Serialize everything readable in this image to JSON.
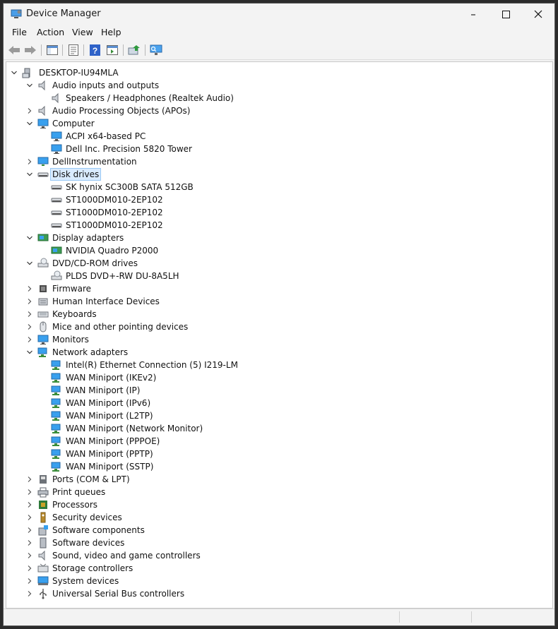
{
  "window": {
    "title": "Device Manager"
  },
  "menu": {
    "items": [
      "File",
      "Action",
      "View",
      "Help"
    ]
  },
  "toolbar": {
    "icons": [
      "back-icon",
      "forward-icon",
      "show-hide-tree-icon",
      "properties-icon",
      "help-icon",
      "action-pane-icon",
      "update-driver-icon",
      "scan-hardware-icon"
    ]
  },
  "tree": {
    "rows": [
      {
        "label": "DESKTOP-IU94MLA",
        "level": 0,
        "expander": "open",
        "icon": "computer-root"
      },
      {
        "label": "Audio inputs and outputs",
        "level": 1,
        "expander": "open",
        "icon": "speaker"
      },
      {
        "label": "Speakers / Headphones (Realtek Audio)",
        "level": 2,
        "expander": "none",
        "icon": "speaker"
      },
      {
        "label": "Audio Processing Objects (APOs)",
        "level": 1,
        "expander": "closed",
        "icon": "speaker"
      },
      {
        "label": "Computer",
        "level": 1,
        "expander": "open",
        "icon": "monitor"
      },
      {
        "label": "ACPI x64-based PC",
        "level": 2,
        "expander": "none",
        "icon": "monitor"
      },
      {
        "label": "Dell Inc. Precision 5820 Tower",
        "level": 2,
        "expander": "none",
        "icon": "monitor"
      },
      {
        "label": "DellInstrumentation",
        "level": 1,
        "expander": "closed",
        "icon": "monitor-net"
      },
      {
        "label": "Disk drives",
        "level": 1,
        "expander": "open",
        "icon": "disk",
        "selected": true
      },
      {
        "label": "SK hynix SC300B SATA 512GB",
        "level": 2,
        "expander": "none",
        "icon": "disk"
      },
      {
        "label": "ST1000DM010-2EP102",
        "level": 2,
        "expander": "none",
        "icon": "disk"
      },
      {
        "label": "ST1000DM010-2EP102",
        "level": 2,
        "expander": "none",
        "icon": "disk"
      },
      {
        "label": "ST1000DM010-2EP102",
        "level": 2,
        "expander": "none",
        "icon": "disk"
      },
      {
        "label": "Display adapters",
        "level": 1,
        "expander": "open",
        "icon": "display-adapter"
      },
      {
        "label": "NVIDIA Quadro P2000",
        "level": 2,
        "expander": "none",
        "icon": "display-adapter"
      },
      {
        "label": "DVD/CD-ROM drives",
        "level": 1,
        "expander": "open",
        "icon": "dvd"
      },
      {
        "label": "PLDS DVD+-RW DU-8A5LH",
        "level": 2,
        "expander": "none",
        "icon": "dvd"
      },
      {
        "label": "Firmware",
        "level": 1,
        "expander": "closed",
        "icon": "chip"
      },
      {
        "label": "Human Interface Devices",
        "level": 1,
        "expander": "closed",
        "icon": "hid"
      },
      {
        "label": "Keyboards",
        "level": 1,
        "expander": "closed",
        "icon": "keyboard"
      },
      {
        "label": "Mice and other pointing devices",
        "level": 1,
        "expander": "closed",
        "icon": "mouse"
      },
      {
        "label": "Monitors",
        "level": 1,
        "expander": "closed",
        "icon": "monitor"
      },
      {
        "label": "Network adapters",
        "level": 1,
        "expander": "open",
        "icon": "network"
      },
      {
        "label": "Intel(R) Ethernet Connection (5) I219-LM",
        "level": 2,
        "expander": "none",
        "icon": "network"
      },
      {
        "label": "WAN Miniport (IKEv2)",
        "level": 2,
        "expander": "none",
        "icon": "network"
      },
      {
        "label": "WAN Miniport (IP)",
        "level": 2,
        "expander": "none",
        "icon": "network"
      },
      {
        "label": "WAN Miniport (IPv6)",
        "level": 2,
        "expander": "none",
        "icon": "network"
      },
      {
        "label": "WAN Miniport (L2TP)",
        "level": 2,
        "expander": "none",
        "icon": "network"
      },
      {
        "label": "WAN Miniport (Network Monitor)",
        "level": 2,
        "expander": "none",
        "icon": "network"
      },
      {
        "label": "WAN Miniport (PPPOE)",
        "level": 2,
        "expander": "none",
        "icon": "network"
      },
      {
        "label": "WAN Miniport (PPTP)",
        "level": 2,
        "expander": "none",
        "icon": "network"
      },
      {
        "label": "WAN Miniport (SSTP)",
        "level": 2,
        "expander": "none",
        "icon": "network"
      },
      {
        "label": "Ports (COM & LPT)",
        "level": 1,
        "expander": "closed",
        "icon": "port"
      },
      {
        "label": "Print queues",
        "level": 1,
        "expander": "closed",
        "icon": "printer"
      },
      {
        "label": "Processors",
        "level": 1,
        "expander": "closed",
        "icon": "processor"
      },
      {
        "label": "Security devices",
        "level": 1,
        "expander": "closed",
        "icon": "security"
      },
      {
        "label": "Software components",
        "level": 1,
        "expander": "closed",
        "icon": "software-component"
      },
      {
        "label": "Software devices",
        "level": 1,
        "expander": "closed",
        "icon": "software-device"
      },
      {
        "label": "Sound, video and game controllers",
        "level": 1,
        "expander": "closed",
        "icon": "speaker"
      },
      {
        "label": "Storage controllers",
        "level": 1,
        "expander": "closed",
        "icon": "storage"
      },
      {
        "label": "System devices",
        "level": 1,
        "expander": "closed",
        "icon": "system"
      },
      {
        "label": "Universal Serial Bus controllers",
        "level": 1,
        "expander": "closed",
        "icon": "usb"
      }
    ]
  },
  "colors": {
    "selection_bg": "#d9ebff",
    "selection_border": "#99c9f5",
    "window_bg": "#f3f3f3",
    "tree_bg": "#ffffff"
  }
}
